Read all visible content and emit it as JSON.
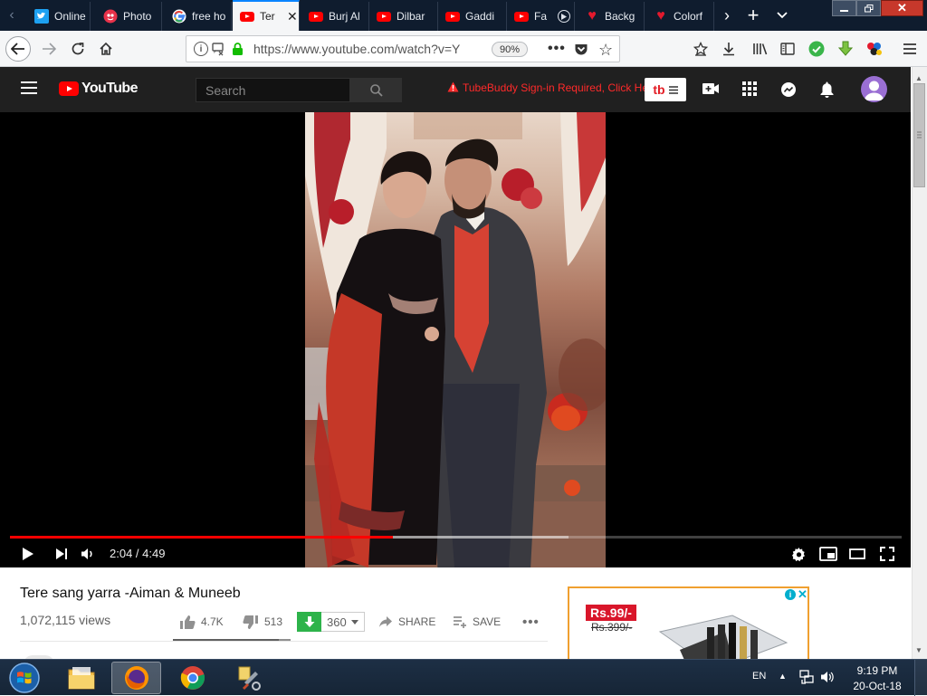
{
  "browser": {
    "tabs": [
      {
        "label": "Online",
        "icon": "twitter-bird-icon"
      },
      {
        "label": "Photo",
        "icon": "photo-app-icon"
      },
      {
        "label": "free ho",
        "icon": "google-icon"
      },
      {
        "label": "Ter",
        "icon": "youtube-icon",
        "active": true
      },
      {
        "label": "Burj Al",
        "icon": "youtube-icon"
      },
      {
        "label": "Dilbar",
        "icon": "youtube-icon"
      },
      {
        "label": "Gaddi",
        "icon": "youtube-icon"
      },
      {
        "label": "Fa",
        "icon": "youtube-icon"
      },
      {
        "label": "Backg",
        "icon": "heart-icon"
      },
      {
        "label": "Colorf",
        "icon": "heart-icon"
      }
    ],
    "url": "https://www.youtube.com/watch?v=Y",
    "zoom": "90%"
  },
  "youtube": {
    "logo_text": "YouTube",
    "search_placeholder": "Search",
    "tubebuddy_warning": "TubeBuddy Sign-in Required, Click Here",
    "tubebuddy_label": "tb"
  },
  "player": {
    "current_time": "2:04",
    "duration": "4:49",
    "time_display": "2:04 / 4:49",
    "played_fraction": 0.429,
    "buffered_fraction": 0.626
  },
  "video": {
    "title": "Tere sang yarra -Aiman & Muneeb",
    "views": "1,072,115 views",
    "likes": "4.7K",
    "dislikes": "513",
    "download_count": "360",
    "share_label": "SHARE",
    "save_label": "SAVE",
    "like_ratio": 0.9
  },
  "ad": {
    "price_new": "Rs.99/-",
    "price_old": "Rs.399/-"
  },
  "taskbar": {
    "language": "EN",
    "time": "9:19 PM",
    "date": "20-Oct-18"
  },
  "colors": {
    "youtube_red": "#ff0000",
    "tab_bar": "#0f1c2e",
    "yt_header": "#202020",
    "tubebuddy_red": "#e31b23",
    "download_green": "#2db34a"
  }
}
